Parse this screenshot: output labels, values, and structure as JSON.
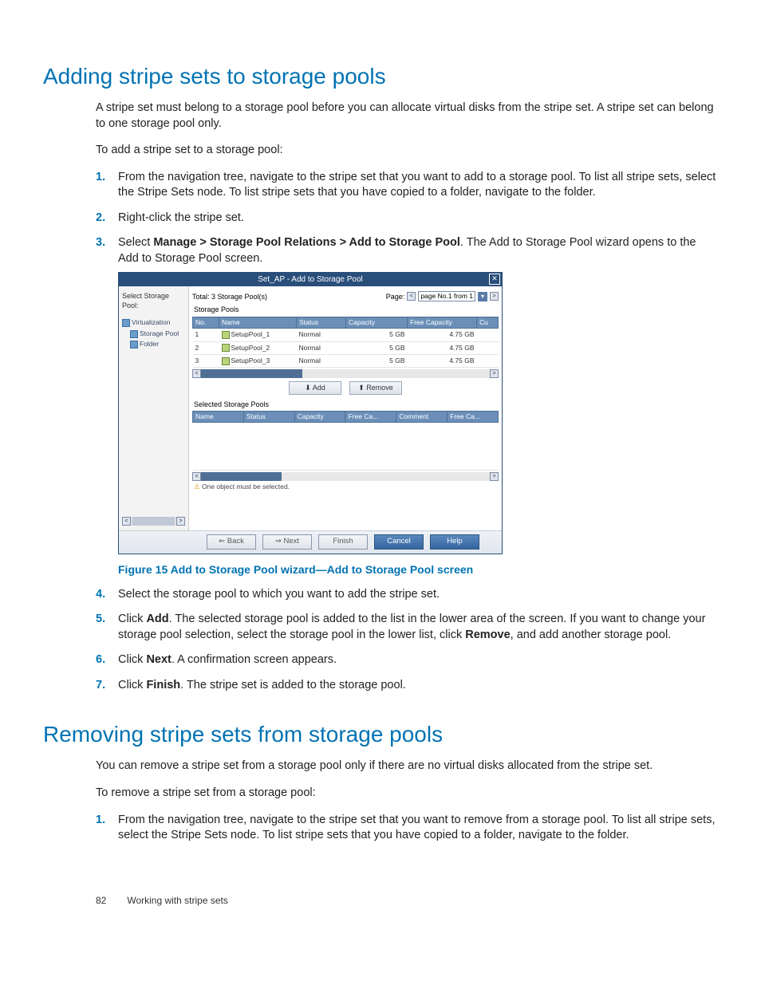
{
  "section1": {
    "heading": "Adding stripe sets to storage pools",
    "para1": "A stripe set must belong to a storage pool before you can allocate virtual disks from the stripe set. A stripe set can belong to one storage pool only.",
    "para2": "To add a stripe set to a storage pool:",
    "steps": [
      "From the navigation tree, navigate to the stripe set that you want to add to a storage pool. To list all stripe sets, select the Stripe Sets node. To list stripe sets that you have copied to a folder, navigate to the folder.",
      "Right-click the stripe set.",
      "",
      "Select the storage pool to which you want to add the stripe set.",
      "",
      "",
      ""
    ],
    "step3_head": "Select ",
    "step3_bold": "Manage > Storage Pool Relations > Add to Storage Pool",
    "step3_tail": ". The Add to Storage Pool wizard opens to the Add to Storage Pool screen.",
    "step5_head": "Click ",
    "step5_bold": "Add",
    "step5_mid": ". The selected storage pool is added to the list in the lower area of the screen. If you want to change your storage pool selection, select the storage pool in the lower list, click ",
    "step5_bold2": "Remove",
    "step5_tail": ", and add another storage pool.",
    "step6_head": "Click ",
    "step6_bold": "Next",
    "step6_tail": ". A confirmation screen appears.",
    "step7_head": "Click ",
    "step7_bold": "Finish",
    "step7_tail": ". The stripe set is added to the storage pool."
  },
  "figure_caption": "Figure 15 Add to Storage Pool wizard—Add to Storage Pool screen",
  "wizard": {
    "title": "Set_AP - Add to Storage Pool",
    "close": "✕",
    "left_header": "Select Storage Pool:",
    "tree": [
      "Virtualization",
      "Storage Pool",
      "Folder"
    ],
    "total": "Total: 3 Storage Pool(s)",
    "page_label": "Page:",
    "page_value": "page No.1 from 1",
    "table1_label": "Storage Pools",
    "table1_headers": [
      "No.",
      "Name",
      "Status",
      "Capacity",
      "Free Capacity",
      "Cu"
    ],
    "table1_rows": [
      [
        "1",
        "SetupPool_1",
        "Normal",
        "5  GB",
        "4.75  GB"
      ],
      [
        "2",
        "SetupPool_2",
        "Normal",
        "5  GB",
        "4.75  GB"
      ],
      [
        "3",
        "SetupPool_3",
        "Normal",
        "5  GB",
        "4.75  GB"
      ]
    ],
    "btn_add": "Add",
    "btn_remove": "Remove",
    "table2_label": "Selected Storage Pools",
    "table2_headers": [
      "Name",
      "Status",
      "Capacity",
      "Free Ca...",
      "Comment",
      "Free Ca..."
    ],
    "msg": "One object must be selected.",
    "footer": {
      "back": "Back",
      "next": "Next",
      "finish": "Finish",
      "cancel": "Cancel",
      "help": "Help"
    }
  },
  "section2": {
    "heading": "Removing stripe sets from storage pools",
    "para1": "You can remove a stripe set from a storage pool only if there are no virtual disks allocated from the stripe set.",
    "para2": "To remove a stripe set from a storage pool:",
    "steps": [
      "From the navigation tree, navigate to the stripe set that you want to remove from a storage pool. To list all stripe sets, select the Stripe Sets node. To list stripe sets that you have copied to a folder, navigate to the folder."
    ]
  },
  "footer": {
    "page": "82",
    "chapter": "Working with stripe sets"
  }
}
